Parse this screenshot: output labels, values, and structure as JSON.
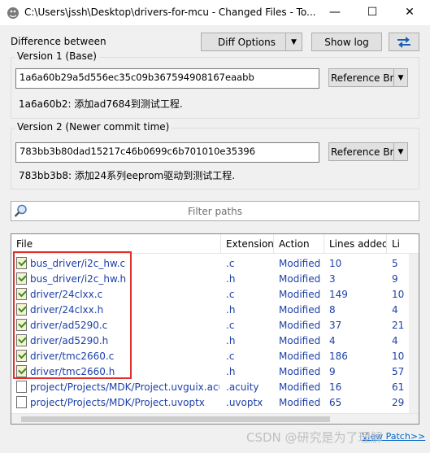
{
  "window": {
    "title": "C:\\Users\\jssh\\Desktop\\drivers-for-mcu - Changed Files - To...",
    "minimize_glyph": "—",
    "maximize_glyph": "☐",
    "close_glyph": "✕"
  },
  "header": {
    "difference_label": "Difference between",
    "diff_options_label": "Diff Options",
    "show_log_label": "Show log",
    "swap_icon": "swap-arrows-icon"
  },
  "version1": {
    "label": "Version 1 (Base)",
    "hash": "1a6a60b29a5d556ec35c09b367594908167eaabb",
    "summary": "1a6a60b2: 添加ad7684到测试工程.",
    "ref_button": "Reference Br..."
  },
  "version2": {
    "label": "Version 2 (Newer commit time)",
    "hash": "783bb3b80dad15217c46b0699c6b701010e35396",
    "summary": "783bb3b8: 添加24系列eeprom驱动到测试工程.",
    "ref_button": "Reference Br..."
  },
  "filter": {
    "placeholder": "Filter paths",
    "icon": "search-icon"
  },
  "table": {
    "columns": [
      "File",
      "Extension",
      "Action",
      "Lines added",
      "Li"
    ],
    "rows": [
      {
        "file": "bus_driver/i2c_hw.c",
        "ext": ".c",
        "action": "Modified",
        "added": "10",
        "removed": "5",
        "icon": "modified-file-icon"
      },
      {
        "file": "bus_driver/i2c_hw.h",
        "ext": ".h",
        "action": "Modified",
        "added": "3",
        "removed": "9",
        "icon": "modified-file-icon"
      },
      {
        "file": "driver/24clxx.c",
        "ext": ".c",
        "action": "Modified",
        "added": "149",
        "removed": "10",
        "icon": "modified-file-icon"
      },
      {
        "file": "driver/24clxx.h",
        "ext": ".h",
        "action": "Modified",
        "added": "8",
        "removed": "4",
        "icon": "modified-file-icon"
      },
      {
        "file": "driver/ad5290.c",
        "ext": ".c",
        "action": "Modified",
        "added": "37",
        "removed": "21",
        "icon": "modified-file-icon"
      },
      {
        "file": "driver/ad5290.h",
        "ext": ".h",
        "action": "Modified",
        "added": "4",
        "removed": "4",
        "icon": "modified-file-icon"
      },
      {
        "file": "driver/tmc2660.c",
        "ext": ".c",
        "action": "Modified",
        "added": "186",
        "removed": "10",
        "icon": "modified-file-icon"
      },
      {
        "file": "driver/tmc2660.h",
        "ext": ".h",
        "action": "Modified",
        "added": "9",
        "removed": "57",
        "icon": "modified-file-icon"
      },
      {
        "file": "project/Projects/MDK/Project.uvguix.acuity",
        "ext": ".acuity",
        "action": "Modified",
        "added": "16",
        "removed": "61",
        "icon": "plain-file-icon"
      },
      {
        "file": "project/Projects/MDK/Project.uvoptx",
        "ext": ".uvoptx",
        "action": "Modified",
        "added": "65",
        "removed": "29",
        "icon": "plain-file-icon"
      }
    ]
  },
  "footer": {
    "view_patch": "View Patch>>",
    "watermark": "CSDN @研究是为了理解"
  },
  "colors": {
    "highlight_box": "#e0302c",
    "link": "#0066cc",
    "row_text": "#1c3fa8"
  }
}
